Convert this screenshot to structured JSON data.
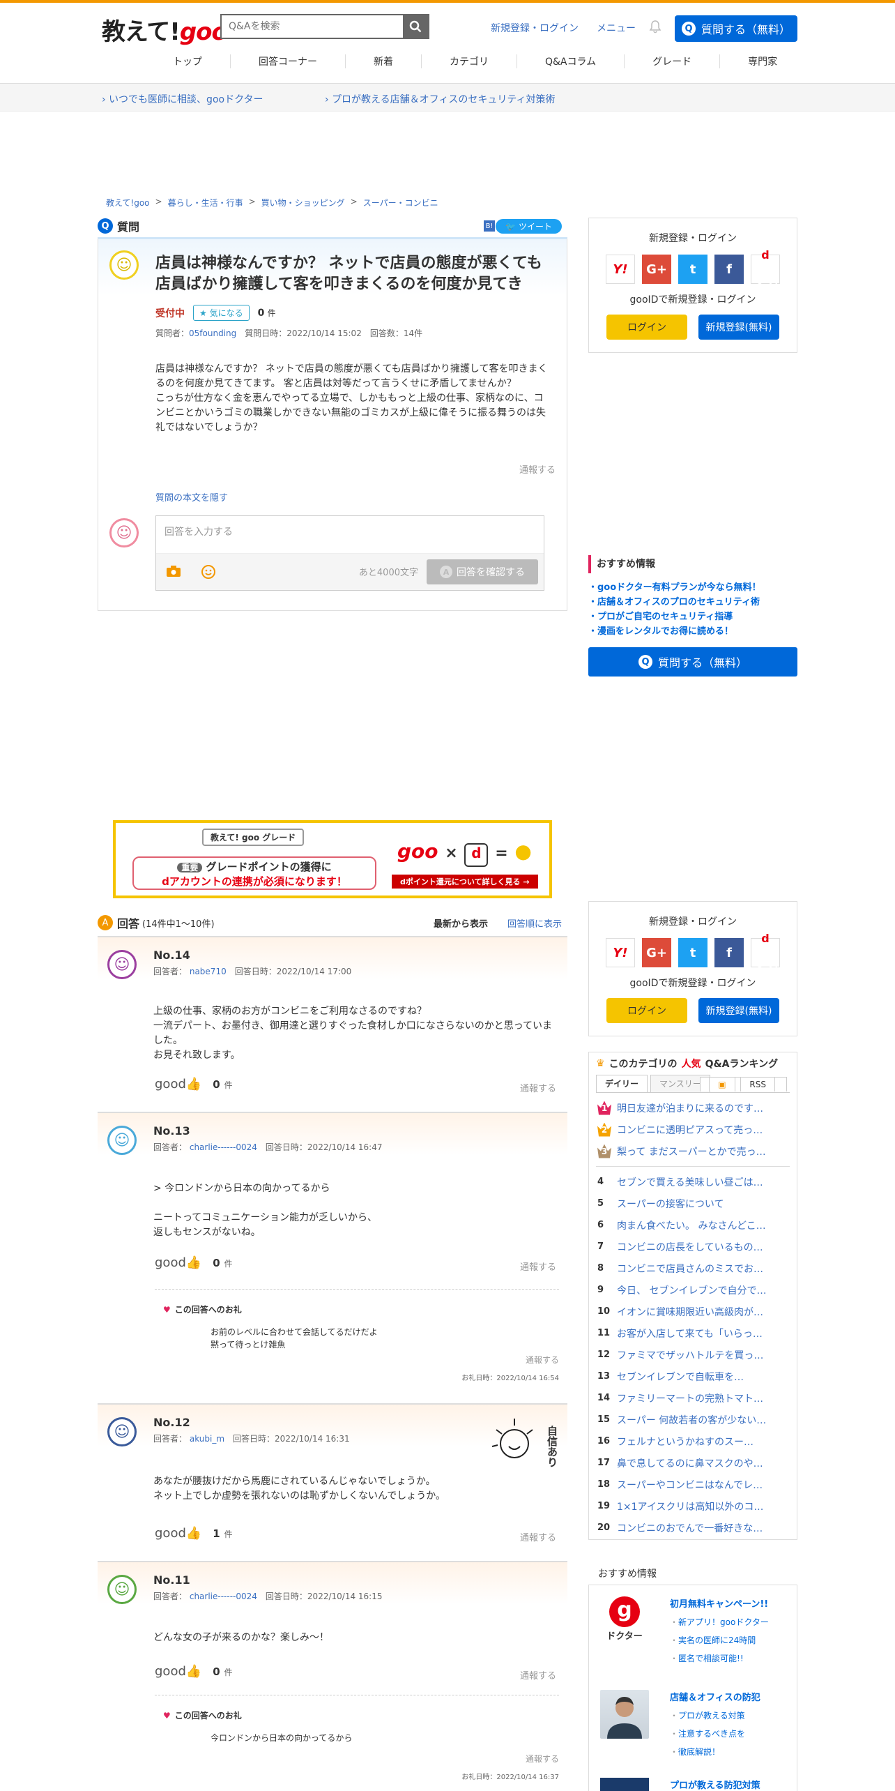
{
  "header": {
    "logo_prefix": "教えて!",
    "logo_goo": "goo",
    "search_placeholder": "Q&Aを検索",
    "links": [
      "新規登録・ログイン",
      "メニュー"
    ],
    "ask_button": "質問する（無料）",
    "nav": [
      "トップ",
      "回答コーナー",
      "新着",
      "カテゴリ",
      "Q&Aコラム",
      "グレード",
      "専門家"
    ]
  },
  "subbar": {
    "link1": "いつでも医師に相談、gooドクター",
    "link2": "プロが教える店舗＆オフィスのセキュリティ対策術"
  },
  "breadcrumb": [
    "教えて!goo",
    "暮らし・生活・行事",
    "買い物・ショッピング",
    "スーパー・コンビニ"
  ],
  "question": {
    "section_label": "質問",
    "tweet": "ツイート",
    "hatena": "B!",
    "title": "店員は神様なんですか？ ネットで店員の態度が悪くても店員ばかり擁護して客を叩きまくるのを何度か見てき",
    "status": "受付中",
    "favorite": "気になる",
    "fav_count": "0",
    "fav_unit": "件",
    "asker_label": "質問者：",
    "asker": "05founding",
    "date_label": "質問日時：2022/10/14 15:02",
    "answer_count": "回答数：14件",
    "body1": "店員は神様なんですか？ ネットで店員の態度が悪くても店員ばかり擁護して客を叩きまくるのを何度か見てきてます。 客と店員は対等だって言うくせに矛盾してませんか？",
    "body2": "こっちが仕方なく金を恵んでやってる立場で、しかももっと上級の仕事、家柄なのに、コンビニとかいうゴミの職業しかできない無能のゴミカスが上級に偉そうに振る舞うのは失礼ではないでしょうか？",
    "report": "通報する",
    "hide": "質問の本文を隠す",
    "answer_placeholder": "回答を入力する",
    "remaining": "あと4000文字",
    "confirm": "回答を確認する"
  },
  "login": {
    "title": "新規登録・ログイン",
    "gooid": "gooIDで新規登録・ログイン",
    "login_btn": "ログイン",
    "register_btn": "新規登録(無料)",
    "docomo": "ログイン"
  },
  "recommend": {
    "title": "おすすめ情報",
    "items": [
      "・gooドクター有料プランが今なら無料！",
      "・店舗＆オフィスのプロのセキュリティ術",
      "・プロがご自宅のセキュリティ指導",
      "・漫画をレンタルでお得に読める！"
    ],
    "ask": "質問する（無料）"
  },
  "banner": {
    "grade_label": "教えて! goo グレード",
    "important": "重要",
    "line1": "グレードポイントの獲得に",
    "line2": "dアカウントの連携が必須になります！",
    "cta": "dポイント還元について詳しく見る →"
  },
  "answers_head": {
    "label": "回答",
    "count": "(14件中1～10件)",
    "sort_new": "最新から表示",
    "sort_order": "回答順に表示"
  },
  "answers": [
    {
      "no": "No.14",
      "meta": "回答者：",
      "user": "nabe710",
      "date": "回答日時：2022/10/14 17:00",
      "body": [
        "上級の仕事、家柄のお方がコンビニをご利用なさるのですね？",
        "一流デパート、お墨付き、御用達と選りすぐった食材しか口になさらないのかと思っていました。",
        "お見それ致します。"
      ],
      "good": "0",
      "unit": "件",
      "report": "通報する"
    },
    {
      "no": "No.13",
      "meta": "回答者：",
      "user": "charlie------0024",
      "date": "回答日時：2022/10/14 16:47",
      "body": [
        "> 今ロンドンから日本の向かってるから",
        "",
        "ニートってコミュニケーション能力が乏しいから、",
        "返しもセンスがないね。"
      ],
      "good": "0",
      "unit": "件",
      "report": "通報する",
      "thanks_title": "この回答へのお礼",
      "thanks_body": [
        "お前のレベルに合わせて会話してるだけだよ",
        "黙って待っとけ雑魚"
      ],
      "thanks_report": "通報する",
      "thanks_date": "お礼日時：2022/10/14 16:54"
    },
    {
      "no": "No.12",
      "meta": "回答者：",
      "user": "akubi_m",
      "date": "回答日時：2022/10/14 16:31",
      "body": [
        "あなたが腰抜けだから馬鹿にされているんじゃないでしょうか。",
        "ネット上でしか虚勢を張れないのは恥ずかしくないんでしょうか。"
      ],
      "good": "1",
      "unit": "件",
      "report": "通報する",
      "badge": "自信あり"
    },
    {
      "no": "No.11",
      "meta": "回答者：",
      "user": "charlie------0024",
      "date": "回答日時：2022/10/14 16:15",
      "body": [
        "どんな女の子が来るのかな？楽しみ～！"
      ],
      "good": "0",
      "unit": "件",
      "report": "通報する",
      "thanks_title": "この回答へのお礼",
      "thanks_body": [
        "今ロンドンから日本の向かってるから"
      ],
      "thanks_report": "通報する",
      "thanks_date": "お礼日時：2022/10/14 16:37"
    }
  ],
  "ranking": {
    "pre": "このカテゴリの",
    "hot": "人気",
    "post": "Q&Aランキング",
    "tab_daily": "デイリー",
    "tab_monthly": "マンスリー",
    "rss": "RSS",
    "items": [
      {
        "n": "1",
        "t": "明日友達が泊まりに来るのです…"
      },
      {
        "n": "2",
        "t": "コンビニに透明ピアスって売っ…"
      },
      {
        "n": "3",
        "t": "梨って まだスーパーとかで売っ…"
      },
      {
        "n": "4",
        "t": "セブンで買える美味しい昼ごは…"
      },
      {
        "n": "5",
        "t": "スーパーの接客について"
      },
      {
        "n": "6",
        "t": "肉まん食べたい。 みなさんどこ…"
      },
      {
        "n": "7",
        "t": "コンビニの店長をしているもの…"
      },
      {
        "n": "8",
        "t": "コンビニで店員さんのミスでお…"
      },
      {
        "n": "9",
        "t": "今日、 セブンイレブンで自分で…"
      },
      {
        "n": "10",
        "t": "イオンに賞味期限近い高級肉が…"
      },
      {
        "n": "11",
        "t": "お客が入店して来ても「いらっ…"
      },
      {
        "n": "12",
        "t": "ファミマでザッハトルテを買っ…"
      },
      {
        "n": "13",
        "t": "セブンイレブンで自転車を…"
      },
      {
        "n": "14",
        "t": "ファミリーマートの完熟トマト…"
      },
      {
        "n": "15",
        "t": "スーパー 何故若者の客が少ない…"
      },
      {
        "n": "16",
        "t": "フェルナというかねすのスー…"
      },
      {
        "n": "17",
        "t": "鼻で息してるのに鼻マスクのや…"
      },
      {
        "n": "18",
        "t": "スーパーやコンビニはなんでレ…"
      },
      {
        "n": "19",
        "t": "1×1アイスクリは高知以外のコ…"
      },
      {
        "n": "20",
        "t": "コンビニのおでんで一番好きな…"
      }
    ]
  },
  "recommend2": {
    "title": "おすすめ情報",
    "item1": {
      "title": "初月無料キャンペーン!!",
      "logo": "ドクター",
      "lines": [
        "新アプリ！gooドクター",
        "実名の医師に24時間",
        "匿名で相談可能!!"
      ]
    },
    "item2": {
      "title": "店舗＆オフィスの防犯",
      "lines": [
        "プロが教える対策",
        "注意するべき点を",
        "徹底解説！"
      ]
    },
    "item3": {
      "title": "プロが教える防犯対策"
    }
  },
  "colors": {
    "accent": "#0068d9",
    "orange": "#f39800",
    "red": "#e60012"
  }
}
